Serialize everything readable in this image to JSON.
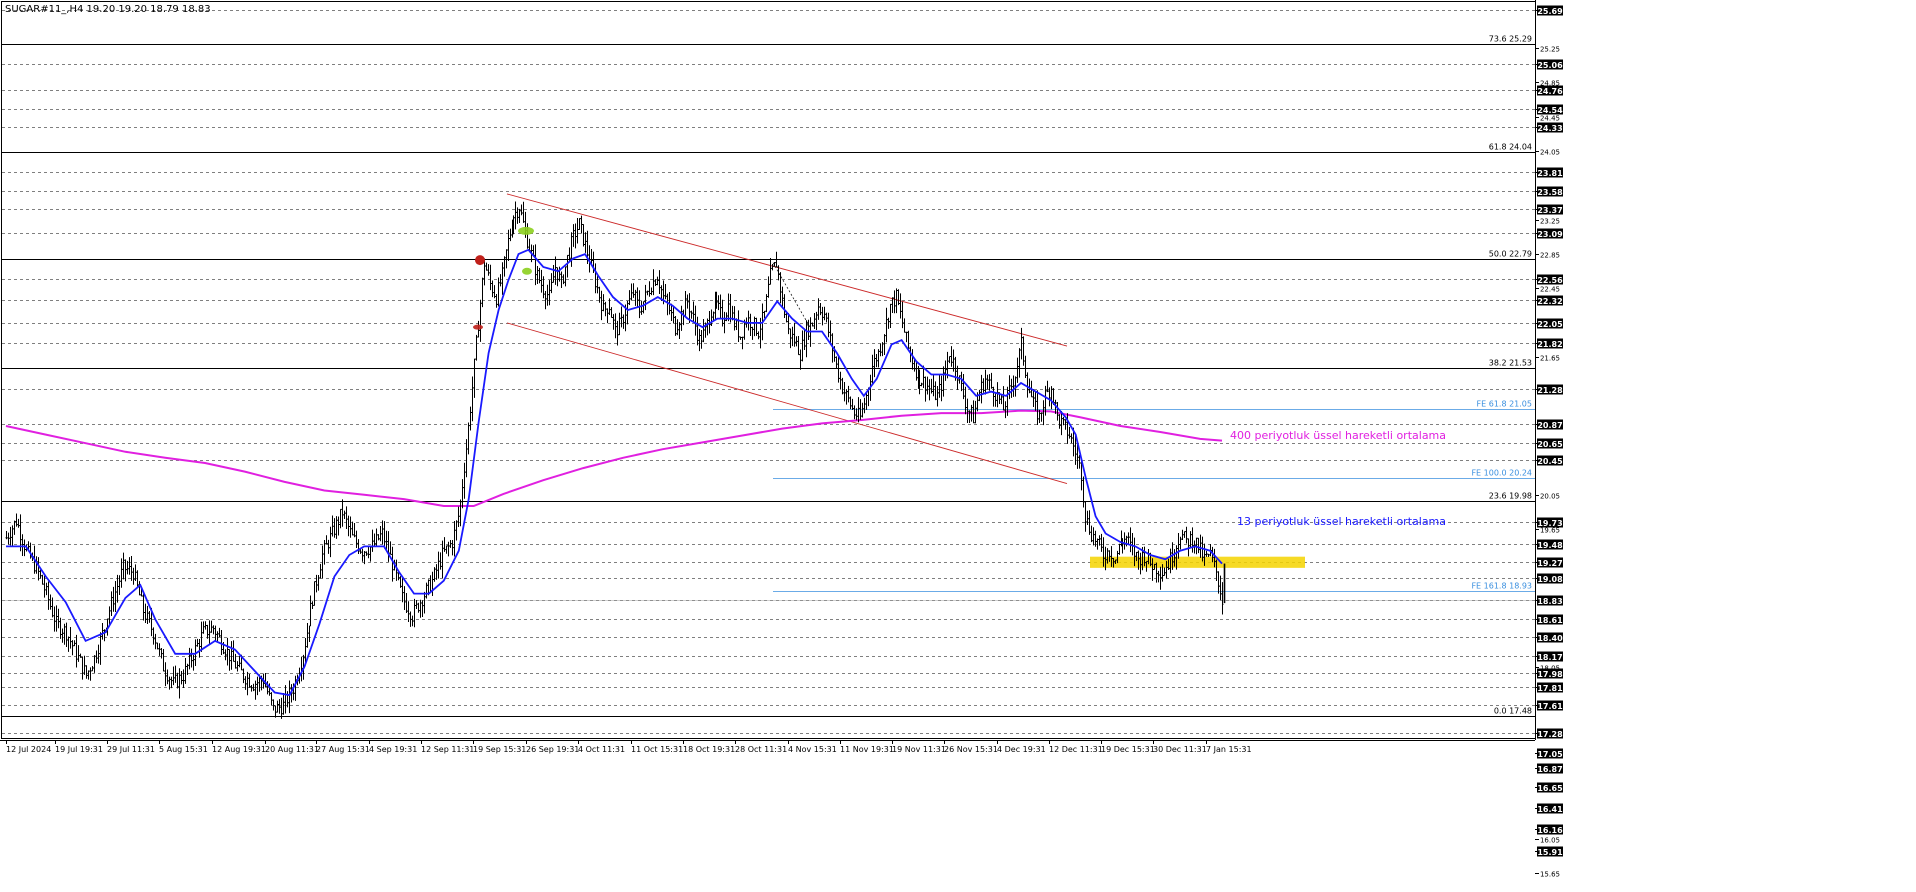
{
  "window": {
    "symbol_title": "SUGAR#11_,H4  19.20 19.20 18.79 18.83"
  },
  "colors": {
    "price": "#000000",
    "ema13": "#1a1aff",
    "ema400": "#e020e0",
    "channel": "#cc2a2a",
    "fib": "#000000",
    "fe": "#3a8fdf",
    "highlight": "#f5d400",
    "grid": "#000000"
  },
  "chart_data": {
    "type": "line",
    "ylim": [
      15.65,
      25.69
    ],
    "price_axis_ticks": [
      "25.69",
      "25.25",
      "25.06",
      "24.85",
      "24.76",
      "24.54",
      "24.45",
      "24.33",
      "24.05",
      "23.81",
      "23.58",
      "23.37",
      "23.25",
      "23.09",
      "22.85",
      "22.56",
      "22.45",
      "22.32",
      "22.05",
      "21.82",
      "21.65",
      "21.28",
      "20.87",
      "20.65",
      "20.45",
      "20.05",
      "19.73",
      "19.65",
      "19.48",
      "19.27",
      "19.08",
      "18.83",
      "18.61",
      "18.40",
      "18.17",
      "18.05",
      "17.98",
      "17.81",
      "17.61",
      "17.28",
      "17.05",
      "16.87",
      "16.65",
      "16.41",
      "16.16",
      "16.05",
      "15.91",
      "15.65"
    ],
    "price_axis_boxed": [
      "25.69",
      "25.06",
      "24.76",
      "24.54",
      "24.33",
      "23.81",
      "23.58",
      "23.37",
      "23.09",
      "22.56",
      "22.32",
      "22.05",
      "21.82",
      "21.28",
      "20.87",
      "20.65",
      "20.45",
      "19.73",
      "19.48",
      "19.27",
      "19.08",
      "18.83",
      "18.61",
      "18.40",
      "18.17",
      "17.98",
      "17.81",
      "17.61",
      "17.28",
      "17.05",
      "16.87",
      "16.65",
      "16.41",
      "16.16",
      "15.91"
    ],
    "time_axis_labels": [
      "12 Jul 2024",
      "19 Jul 19:31",
      "29 Jul 11:31",
      "5 Aug 15:31",
      "12 Aug 19:31",
      "20 Aug 11:31",
      "27 Aug 15:31",
      "4 Sep 19:31",
      "12 Sep 11:31",
      "19 Sep 15:31",
      "26 Sep 19:31",
      "4 Oct 11:31",
      "11 Oct 15:31",
      "18 Oct 19:31",
      "28 Oct 11:31",
      "4 Nov 15:31",
      "11 Nov 19:31",
      "19 Nov 11:31",
      "26 Nov 15:31",
      "4 Dec 19:31",
      "12 Dec 11:31",
      "19 Dec 15:31",
      "30 Dec 11:31",
      "7 Jan 15:31"
    ],
    "fib_levels": [
      {
        "label": "73.6 25.29",
        "value": 25.29
      },
      {
        "label": "61.8 24.04",
        "value": 24.04
      },
      {
        "label": "50.0 22.79",
        "value": 22.79
      },
      {
        "label": "38.2 21.53",
        "value": 21.53
      },
      {
        "label": "23.6 19.98",
        "value": 19.98
      },
      {
        "label": "0.0 17.48",
        "value": 17.48
      }
    ],
    "fe_levels": [
      {
        "label": "FE 61.8 21.05",
        "value": 21.05
      },
      {
        "label": "FE 100.0 20.24",
        "value": 20.24
      },
      {
        "label": "FE 161.8 18.93",
        "value": 18.93
      }
    ],
    "close_line": 18.83,
    "channel": {
      "upper": [
        [
          23.55,
          0
        ],
        [
          21.78,
          1
        ]
      ],
      "lower": [
        [
          22.05,
          0
        ],
        [
          20.18,
          1
        ]
      ]
    },
    "annotations": {
      "ema400": "400 periyotluk üssel hareketli ortalama",
      "ema13": "13 periyotluk üssel hareketli ortalama"
    },
    "highlight_zone": [
      19.2,
      19.33
    ],
    "price_path": [
      [
        0,
        19.55
      ],
      [
        10,
        19.75
      ],
      [
        20,
        19.4
      ],
      [
        30,
        19.2
      ],
      [
        40,
        18.9
      ],
      [
        50,
        18.55
      ],
      [
        60,
        18.45
      ],
      [
        70,
        18.2
      ],
      [
        80,
        17.95
      ],
      [
        88,
        18.15
      ],
      [
        98,
        18.5
      ],
      [
        108,
        18.85
      ],
      [
        118,
        19.2
      ],
      [
        128,
        19.15
      ],
      [
        138,
        18.7
      ],
      [
        148,
        18.45
      ],
      [
        158,
        18.05
      ],
      [
        168,
        17.85
      ],
      [
        178,
        17.95
      ],
      [
        188,
        18.2
      ],
      [
        198,
        18.45
      ],
      [
        208,
        18.5
      ],
      [
        218,
        18.3
      ],
      [
        228,
        18.1
      ],
      [
        238,
        17.95
      ],
      [
        248,
        17.85
      ],
      [
        258,
        17.9
      ],
      [
        268,
        17.55
      ],
      [
        278,
        17.6
      ],
      [
        288,
        17.8
      ],
      [
        298,
        18.2
      ],
      [
        308,
        18.85
      ],
      [
        318,
        19.35
      ],
      [
        328,
        19.6
      ],
      [
        338,
        19.85
      ],
      [
        348,
        19.55
      ],
      [
        358,
        19.4
      ],
      [
        368,
        19.45
      ],
      [
        378,
        19.6
      ],
      [
        388,
        19.25
      ],
      [
        398,
        18.85
      ],
      [
        408,
        18.65
      ],
      [
        418,
        18.85
      ],
      [
        428,
        19.05
      ],
      [
        438,
        19.35
      ],
      [
        448,
        19.5
      ],
      [
        455,
        19.85
      ],
      [
        462,
        20.6
      ],
      [
        468,
        21.3
      ],
      [
        474,
        22.05
      ],
      [
        480,
        22.75
      ],
      [
        486,
        22.5
      ],
      [
        492,
        22.35
      ],
      [
        498,
        22.6
      ],
      [
        504,
        23.0
      ],
      [
        510,
        23.3
      ],
      [
        516,
        23.4
      ],
      [
        522,
        23.1
      ],
      [
        528,
        22.85
      ],
      [
        534,
        22.6
      ],
      [
        540,
        22.45
      ],
      [
        546,
        22.35
      ],
      [
        552,
        22.7
      ],
      [
        558,
        22.5
      ],
      [
        564,
        22.8
      ],
      [
        570,
        23.05
      ],
      [
        576,
        23.2
      ],
      [
        582,
        22.95
      ],
      [
        588,
        22.7
      ],
      [
        594,
        22.45
      ],
      [
        600,
        22.2
      ],
      [
        606,
        22.25
      ],
      [
        612,
        21.95
      ],
      [
        618,
        22.05
      ],
      [
        624,
        22.25
      ],
      [
        630,
        22.4
      ],
      [
        636,
        22.2
      ],
      [
        642,
        22.35
      ],
      [
        648,
        22.5
      ],
      [
        654,
        22.6
      ],
      [
        660,
        22.35
      ],
      [
        666,
        22.2
      ],
      [
        672,
        22.0
      ],
      [
        678,
        22.15
      ],
      [
        684,
        22.3
      ],
      [
        690,
        22.1
      ],
      [
        696,
        21.85
      ],
      [
        702,
        21.95
      ],
      [
        708,
        22.2
      ],
      [
        714,
        22.25
      ],
      [
        720,
        22.1
      ],
      [
        726,
        22.25
      ],
      [
        732,
        22.05
      ],
      [
        738,
        21.9
      ],
      [
        744,
        22.1
      ],
      [
        750,
        22.05
      ],
      [
        756,
        21.95
      ],
      [
        762,
        22.15
      ],
      [
        768,
        22.6
      ],
      [
        774,
        22.75
      ],
      [
        780,
        22.3
      ],
      [
        786,
        21.95
      ],
      [
        792,
        21.85
      ],
      [
        798,
        21.7
      ],
      [
        804,
        21.95
      ],
      [
        810,
        22.05
      ],
      [
        816,
        22.25
      ],
      [
        822,
        22.15
      ],
      [
        828,
        21.85
      ],
      [
        834,
        21.55
      ],
      [
        840,
        21.3
      ],
      [
        846,
        21.15
      ],
      [
        852,
        21.0
      ],
      [
        858,
        20.95
      ],
      [
        864,
        21.2
      ],
      [
        870,
        21.55
      ],
      [
        876,
        21.7
      ],
      [
        882,
        21.95
      ],
      [
        888,
        22.25
      ],
      [
        894,
        22.35
      ],
      [
        900,
        22.05
      ],
      [
        906,
        21.75
      ],
      [
        912,
        21.55
      ],
      [
        918,
        21.4
      ],
      [
        924,
        21.35
      ],
      [
        930,
        21.25
      ],
      [
        936,
        21.2
      ],
      [
        942,
        21.4
      ],
      [
        948,
        21.7
      ],
      [
        954,
        21.55
      ],
      [
        960,
        21.3
      ],
      [
        966,
        21.05
      ],
      [
        972,
        20.95
      ],
      [
        978,
        21.25
      ],
      [
        984,
        21.4
      ],
      [
        990,
        21.3
      ],
      [
        996,
        21.2
      ],
      [
        1002,
        21.05
      ],
      [
        1008,
        21.25
      ],
      [
        1014,
        21.45
      ],
      [
        1020,
        21.8
      ],
      [
        1026,
        21.35
      ],
      [
        1032,
        21.1
      ],
      [
        1038,
        20.95
      ],
      [
        1044,
        21.2
      ],
      [
        1050,
        21.3
      ],
      [
        1056,
        20.95
      ],
      [
        1062,
        20.85
      ],
      [
        1068,
        20.75
      ],
      [
        1074,
        20.55
      ],
      [
        1080,
        20.3
      ],
      [
        1084,
        19.8
      ],
      [
        1090,
        19.6
      ],
      [
        1096,
        19.5
      ],
      [
        1102,
        19.35
      ],
      [
        1108,
        19.4
      ],
      [
        1114,
        19.3
      ],
      [
        1120,
        19.5
      ],
      [
        1126,
        19.55
      ],
      [
        1132,
        19.4
      ],
      [
        1138,
        19.3
      ],
      [
        1144,
        19.35
      ],
      [
        1150,
        19.25
      ],
      [
        1156,
        19.2
      ],
      [
        1162,
        19.15
      ],
      [
        1168,
        19.25
      ],
      [
        1174,
        19.4
      ],
      [
        1180,
        19.6
      ],
      [
        1186,
        19.5
      ],
      [
        1192,
        19.55
      ],
      [
        1198,
        19.45
      ],
      [
        1204,
        19.3
      ],
      [
        1210,
        19.35
      ],
      [
        1216,
        19.15
      ],
      [
        1222,
        18.83
      ]
    ],
    "ema13_path": [
      [
        0,
        19.45
      ],
      [
        20,
        19.45
      ],
      [
        40,
        19.1
      ],
      [
        60,
        18.8
      ],
      [
        80,
        18.35
      ],
      [
        100,
        18.45
      ],
      [
        120,
        18.85
      ],
      [
        135,
        19.0
      ],
      [
        150,
        18.6
      ],
      [
        170,
        18.2
      ],
      [
        190,
        18.2
      ],
      [
        210,
        18.35
      ],
      [
        230,
        18.25
      ],
      [
        250,
        18.0
      ],
      [
        270,
        17.75
      ],
      [
        285,
        17.72
      ],
      [
        300,
        18.05
      ],
      [
        315,
        18.55
      ],
      [
        330,
        19.1
      ],
      [
        345,
        19.35
      ],
      [
        360,
        19.45
      ],
      [
        380,
        19.45
      ],
      [
        395,
        19.15
      ],
      [
        410,
        18.9
      ],
      [
        425,
        18.9
      ],
      [
        440,
        19.05
      ],
      [
        455,
        19.4
      ],
      [
        465,
        20.0
      ],
      [
        475,
        20.9
      ],
      [
        485,
        21.7
      ],
      [
        495,
        22.2
      ],
      [
        505,
        22.55
      ],
      [
        515,
        22.85
      ],
      [
        525,
        22.9
      ],
      [
        540,
        22.7
      ],
      [
        555,
        22.65
      ],
      [
        570,
        22.8
      ],
      [
        582,
        22.85
      ],
      [
        595,
        22.6
      ],
      [
        610,
        22.35
      ],
      [
        625,
        22.2
      ],
      [
        640,
        22.25
      ],
      [
        655,
        22.35
      ],
      [
        670,
        22.25
      ],
      [
        685,
        22.1
      ],
      [
        700,
        22.0
      ],
      [
        715,
        22.1
      ],
      [
        730,
        22.1
      ],
      [
        745,
        22.05
      ],
      [
        760,
        22.05
      ],
      [
        775,
        22.3
      ],
      [
        790,
        22.1
      ],
      [
        805,
        21.95
      ],
      [
        820,
        21.95
      ],
      [
        835,
        21.7
      ],
      [
        850,
        21.4
      ],
      [
        862,
        21.2
      ],
      [
        875,
        21.4
      ],
      [
        890,
        21.8
      ],
      [
        900,
        21.85
      ],
      [
        915,
        21.6
      ],
      [
        930,
        21.45
      ],
      [
        945,
        21.45
      ],
      [
        960,
        21.4
      ],
      [
        975,
        21.2
      ],
      [
        990,
        21.25
      ],
      [
        1005,
        21.2
      ],
      [
        1020,
        21.35
      ],
      [
        1035,
        21.25
      ],
      [
        1050,
        21.15
      ],
      [
        1065,
        20.95
      ],
      [
        1075,
        20.75
      ],
      [
        1085,
        20.25
      ],
      [
        1095,
        19.8
      ],
      [
        1105,
        19.6
      ],
      [
        1120,
        19.5
      ],
      [
        1135,
        19.45
      ],
      [
        1150,
        19.35
      ],
      [
        1165,
        19.3
      ],
      [
        1180,
        19.4
      ],
      [
        1195,
        19.45
      ],
      [
        1210,
        19.4
      ],
      [
        1222,
        19.25
      ]
    ],
    "ema400_path": [
      [
        0,
        20.85
      ],
      [
        40,
        20.75
      ],
      [
        80,
        20.65
      ],
      [
        120,
        20.55
      ],
      [
        160,
        20.48
      ],
      [
        200,
        20.42
      ],
      [
        240,
        20.32
      ],
      [
        280,
        20.2
      ],
      [
        320,
        20.1
      ],
      [
        360,
        20.05
      ],
      [
        400,
        20.0
      ],
      [
        440,
        19.92
      ],
      [
        470,
        19.92
      ],
      [
        500,
        20.06
      ],
      [
        540,
        20.22
      ],
      [
        580,
        20.36
      ],
      [
        620,
        20.48
      ],
      [
        660,
        20.58
      ],
      [
        700,
        20.66
      ],
      [
        740,
        20.74
      ],
      [
        780,
        20.82
      ],
      [
        820,
        20.88
      ],
      [
        860,
        20.92
      ],
      [
        900,
        20.97
      ],
      [
        940,
        21.0
      ],
      [
        980,
        21.0
      ],
      [
        1020,
        21.03
      ],
      [
        1050,
        21.02
      ],
      [
        1080,
        20.95
      ],
      [
        1120,
        20.85
      ],
      [
        1160,
        20.78
      ],
      [
        1200,
        20.7
      ],
      [
        1222,
        20.68
      ]
    ]
  }
}
